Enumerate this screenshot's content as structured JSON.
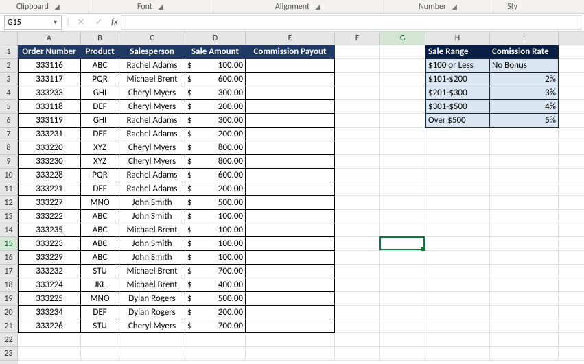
{
  "ribbon": {
    "clipboard": "Clipboard",
    "font": "Font",
    "alignment": "Alignment",
    "number": "Number",
    "styles": "Sty"
  },
  "namebox": {
    "value": "G15"
  },
  "formula": {
    "fx": "fx",
    "value": ""
  },
  "columns": [
    "A",
    "B",
    "C",
    "D",
    "E",
    "F",
    "G",
    "H",
    "I"
  ],
  "row_numbers": [
    1,
    2,
    3,
    4,
    5,
    6,
    7,
    8,
    9,
    10,
    11,
    12,
    13,
    14,
    15,
    16,
    17,
    18,
    19,
    20,
    21,
    22,
    23
  ],
  "active_cell": {
    "row": 15,
    "col": "G"
  },
  "headers": {
    "A": "Order Number",
    "B": "Product",
    "C": "Salesperson",
    "D": "Sale Amount",
    "E": "Commission Payout"
  },
  "currency": "$",
  "orders": [
    {
      "num": "333116",
      "product": "ABC",
      "sales": "Rachel Adams",
      "amt": "100.00"
    },
    {
      "num": "333117",
      "product": "PQR",
      "sales": "Michael Brent",
      "amt": "600.00"
    },
    {
      "num": "333233",
      "product": "GHI",
      "sales": "Cheryl Myers",
      "amt": "300.00"
    },
    {
      "num": "333118",
      "product": "DEF",
      "sales": "Cheryl Myers",
      "amt": "200.00"
    },
    {
      "num": "333119",
      "product": "GHI",
      "sales": "Rachel Adams",
      "amt": "300.00"
    },
    {
      "num": "333231",
      "product": "DEF",
      "sales": "Rachel Adams",
      "amt": "200.00"
    },
    {
      "num": "333220",
      "product": "XYZ",
      "sales": "Cheryl Myers",
      "amt": "800.00"
    },
    {
      "num": "333230",
      "product": "XYZ",
      "sales": "Cheryl Myers",
      "amt": "800.00"
    },
    {
      "num": "333228",
      "product": "PQR",
      "sales": "Rachel Adams",
      "amt": "600.00"
    },
    {
      "num": "333221",
      "product": "DEF",
      "sales": "Rachel Adams",
      "amt": "200.00"
    },
    {
      "num": "333227",
      "product": "MNO",
      "sales": "John Smith",
      "amt": "500.00"
    },
    {
      "num": "333222",
      "product": "ABC",
      "sales": "John Smith",
      "amt": "100.00"
    },
    {
      "num": "333235",
      "product": "ABC",
      "sales": "Michael Brent",
      "amt": "100.00"
    },
    {
      "num": "333223",
      "product": "ABC",
      "sales": "John Smith",
      "amt": "100.00"
    },
    {
      "num": "333229",
      "product": "ABC",
      "sales": "John Smith",
      "amt": "100.00"
    },
    {
      "num": "333232",
      "product": "STU",
      "sales": "Michael Brent",
      "amt": "700.00"
    },
    {
      "num": "333224",
      "product": "JKL",
      "sales": "Michael Brent",
      "amt": "400.00"
    },
    {
      "num": "333225",
      "product": "MNO",
      "sales": "Dylan Rogers",
      "amt": "500.00"
    },
    {
      "num": "333234",
      "product": "DEF",
      "sales": "Dylan Rogers",
      "amt": "200.00"
    },
    {
      "num": "333226",
      "product": "STU",
      "sales": "Cheryl Myers",
      "amt": "700.00"
    }
  ],
  "lookup": {
    "h1": "Sale Range",
    "h2": "Comission Rate",
    "rows": [
      {
        "range": "$100 or Less",
        "rate": "No Bonus"
      },
      {
        "range": "$101-$200",
        "rate": "2%"
      },
      {
        "range": "$201-$300",
        "rate": "3%"
      },
      {
        "range": "$301-$500",
        "rate": "4%"
      },
      {
        "range": "Over $500",
        "rate": "5%"
      }
    ]
  }
}
